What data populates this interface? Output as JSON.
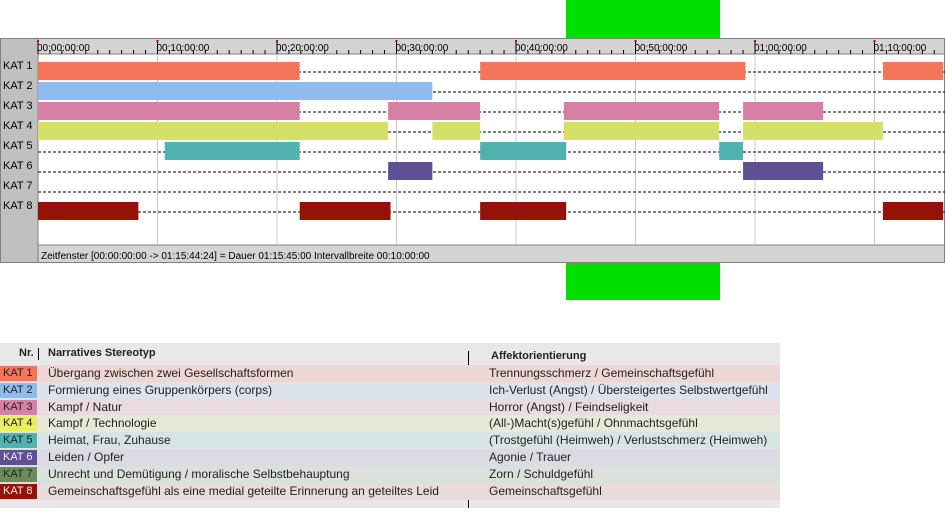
{
  "timeline": {
    "tick_labels": [
      "00:00:00:00",
      "00:10:00:00",
      "00:20:00:00",
      "00:30:00:00",
      "00:40:00:00",
      "00:50:00:00",
      "01:00:00:00",
      "01:10:00:00"
    ],
    "status": "Zeitfenster [00:00:00:00 -> 01:15:44:24] = Dauer 01:15:45:00     Intervallbreite 00:10:00:00"
  },
  "chart_data": {
    "type": "gantt",
    "x_unit": "minutes",
    "xlim": [
      0,
      75.75
    ],
    "tick_minutes": [
      0,
      10,
      20,
      30,
      40,
      50,
      60,
      70
    ],
    "grid": true,
    "categories": [
      {
        "label": "KAT 1",
        "color": "#f4765a",
        "segments": [
          [
            0,
            21.9
          ],
          [
            37,
            59.2
          ],
          [
            70.7,
            75.75
          ]
        ]
      },
      {
        "label": "KAT 2",
        "color": "#8fbbee",
        "segments": [
          [
            0,
            33
          ]
        ]
      },
      {
        "label": "KAT 3",
        "color": "#d580a4",
        "segments": [
          [
            0,
            21.9
          ],
          [
            29.3,
            37
          ],
          [
            44,
            57
          ],
          [
            59,
            65.7
          ]
        ]
      },
      {
        "label": "KAT 4",
        "color": "#d5e06b",
        "segments": [
          [
            0,
            29.3
          ],
          [
            33,
            37
          ],
          [
            44,
            57
          ],
          [
            59,
            70.7
          ]
        ]
      },
      {
        "label": "KAT 5",
        "color": "#52b2b0",
        "segments": [
          [
            10.6,
            21.9
          ],
          [
            37,
            44.2
          ],
          [
            57,
            59
          ]
        ]
      },
      {
        "label": "KAT 6",
        "color": "#5f5096",
        "segments": [
          [
            29.3,
            33
          ],
          [
            59,
            65.7
          ]
        ]
      },
      {
        "label": "KAT 7",
        "color": "#6b8c5a",
        "segments": []
      },
      {
        "label": "KAT 8",
        "color": "#941208",
        "segments": [
          [
            0,
            8.4
          ],
          [
            21.9,
            29.5
          ],
          [
            37,
            44.2
          ],
          [
            70.7,
            75.75
          ]
        ]
      }
    ]
  },
  "legend": {
    "col1_header": "Nr.",
    "col2_header": "Narratives Stereotyp",
    "col3_header": "Affektorientierung",
    "rows": [
      {
        "kat": "KAT 1",
        "color": "#f4765a",
        "bg": "#eed6d2",
        "stereotyp": "Übergang zwischen zwei Gesellschaftsformen",
        "affekt": "Trennungsschmerz / Gemeinschaftsgefühl"
      },
      {
        "kat": "KAT 2",
        "color": "#8fbbee",
        "bg": "#dde3ec",
        "stereotyp": "Formierung eines Gruppenkörpers (corps)",
        "affekt": "Ich-Verlust (Angst) / Übersteigertes Selbstwertgefühl"
      },
      {
        "kat": "KAT 3",
        "color": "#d580a4",
        "bg": "#e9dbe1",
        "stereotyp": "Kampf / Natur",
        "affekt": "Horror (Angst) / Feindseligkeit"
      },
      {
        "kat": "KAT 4",
        "color": "#e8ee60",
        "bg": "#e7e8d8",
        "stereotyp": "Kampf / Technologie",
        "affekt": "(All-)Macht(s)gefühl / Ohnmachtsgefühl"
      },
      {
        "kat": "KAT 5",
        "color": "#52b2b0",
        "bg": "#d6e5e4",
        "stereotyp": "Heimat, Frau, Zuhause",
        "affekt": "(Trostgefühl (Heimweh) / Verlustschmerz (Heimweh)"
      },
      {
        "kat": "KAT 6",
        "color": "#5f5096",
        "bg": "#dcdae3",
        "stereotyp": "Leiden / Opfer",
        "affekt": "Agonie / Trauer"
      },
      {
        "kat": "KAT 7",
        "color": "#6b8c5a",
        "bg": "#dbe0da",
        "stereotyp": "Unrecht und Demütigung / moralische Selbstbehauptung",
        "affekt": "Zorn / Schuldgefühl"
      },
      {
        "kat": "KAT 8",
        "color": "#941208",
        "bg": "#e8dbdb",
        "stereotyp": "Gemeinschaftsgefühl als eine medial geteilte Erinnerung an geteiltes Leid",
        "affekt": "Gemeinschaftsgefühl"
      }
    ]
  }
}
